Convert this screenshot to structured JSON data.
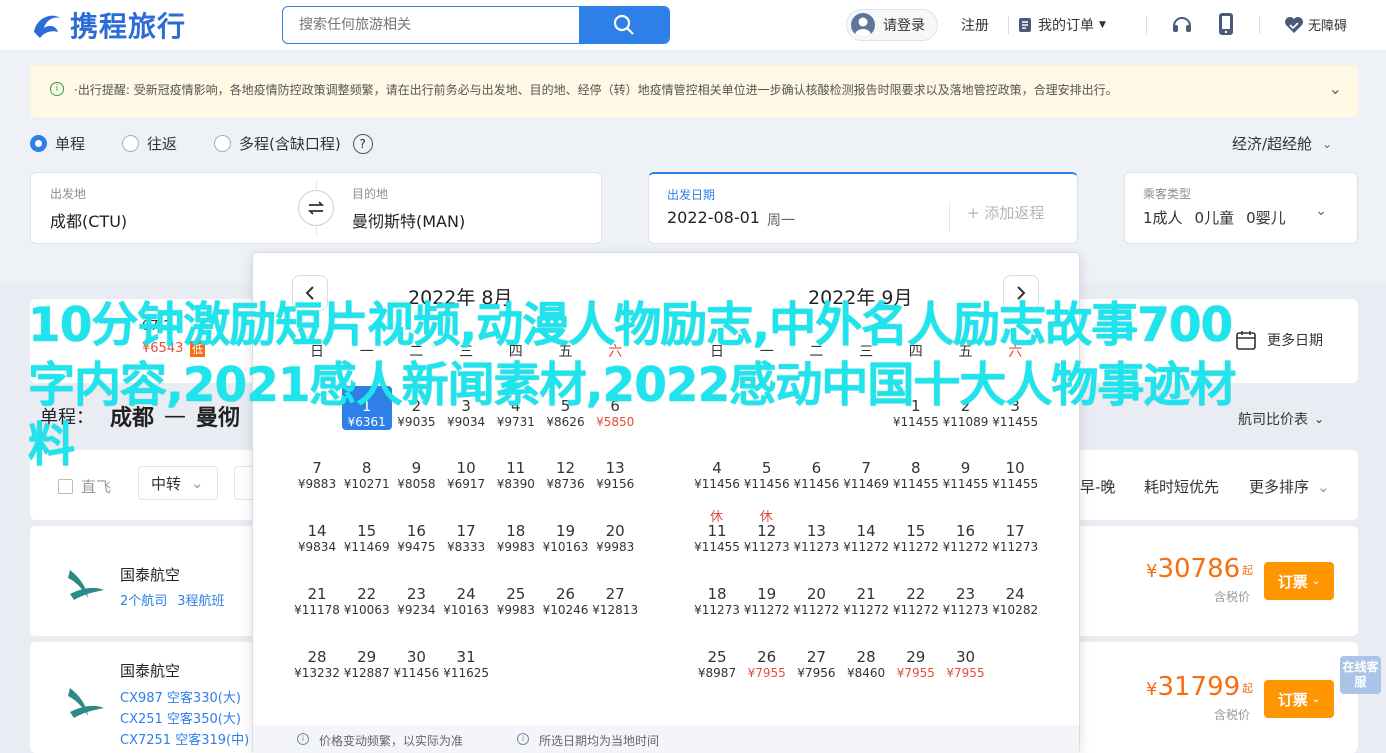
{
  "brand": {
    "name": "携程旅行",
    "color": "#2b6cd8"
  },
  "search": {
    "placeholder": "搜索任何旅游相关"
  },
  "header": {
    "login": "请登录",
    "register": "注册",
    "orders": "我的订单",
    "accessibility": "无障碍"
  },
  "notice": {
    "text": "·出行提醒: 受新冠疫情影响，各地疫情防控政策调整频繁，请在出行前务必与出发地、目的地、经停（转）地疫情管控相关单位进一步确认核酸检测报告时限要求以及落地管控政策，合理安排出行。"
  },
  "trip": {
    "oneway": "单程",
    "roundtrip": "往返",
    "multi": "多程(含缺口程)",
    "cabin": "经济/超经舱"
  },
  "form": {
    "from_label": "出发地",
    "from_value": "成都(CTU)",
    "to_label": "目的地",
    "to_value": "曼彻斯特(MAN)",
    "date_label": "出发日期",
    "date_value": "2022-08-01",
    "date_weekday": "周一",
    "add_return": "+ 添加返程",
    "pax_label": "乘客类型",
    "pax_adult": "1成人",
    "pax_child": "0儿童",
    "pax_infant": "0婴儿"
  },
  "strip": {
    "left_date_partial": "07-2",
    "left_price_partial": "¥6543",
    "left_badge": "低",
    "more_dates": "更多日期"
  },
  "route": {
    "prefix": "单程：",
    "from": "成都",
    "to_partial": "曼彻"
  },
  "sort": {
    "price_trend": "航司比价表"
  },
  "filters": {
    "direct": "直飞",
    "transfer": "中转",
    "time": "早-晚",
    "shortest": "耗时短优先",
    "more_sort": "更多排序"
  },
  "flights": [
    {
      "airline": "国泰航空",
      "sub1": "2个航司",
      "sub2": "3程航班",
      "price": "30786",
      "qi": "起",
      "tax": "含税价",
      "book": "订票"
    },
    {
      "airline": "国泰航空",
      "legs": [
        "CX987 空客330(大)",
        "CX251 空客350(大)",
        "CX7251 空客319(中)"
      ],
      "price": "31799",
      "qi": "起",
      "tax": "含税价",
      "book": "订票"
    }
  ],
  "calendar": {
    "weekdays": [
      "日",
      "一",
      "二",
      "三",
      "四",
      "五",
      "六"
    ],
    "months": [
      {
        "title": "2022年 8月",
        "first_weekday": 1,
        "days": [
          {
            "d": "1",
            "p": "¥6361",
            "sel": true
          },
          {
            "d": "2",
            "p": "¥9035"
          },
          {
            "d": "3",
            "p": "¥9034"
          },
          {
            "d": "4",
            "p": "¥9731"
          },
          {
            "d": "5",
            "p": "¥8626"
          },
          {
            "d": "6",
            "p": "¥5850",
            "low": true
          },
          {
            "d": "7",
            "p": "¥9883"
          },
          {
            "d": "8",
            "p": "¥10271"
          },
          {
            "d": "9",
            "p": "¥8058"
          },
          {
            "d": "10",
            "p": "¥6917"
          },
          {
            "d": "11",
            "p": "¥8390"
          },
          {
            "d": "12",
            "p": "¥8736"
          },
          {
            "d": "13",
            "p": "¥9156"
          },
          {
            "d": "14",
            "p": "¥9834"
          },
          {
            "d": "15",
            "p": "¥11469"
          },
          {
            "d": "16",
            "p": "¥9475"
          },
          {
            "d": "17",
            "p": "¥8333"
          },
          {
            "d": "18",
            "p": "¥9983"
          },
          {
            "d": "19",
            "p": "¥10163"
          },
          {
            "d": "20",
            "p": "¥9983"
          },
          {
            "d": "21",
            "p": "¥11178"
          },
          {
            "d": "22",
            "p": "¥10063"
          },
          {
            "d": "23",
            "p": "¥9234"
          },
          {
            "d": "24",
            "p": "¥10163"
          },
          {
            "d": "25",
            "p": "¥9983"
          },
          {
            "d": "26",
            "p": "¥10246"
          },
          {
            "d": "27",
            "p": "¥12813"
          },
          {
            "d": "28",
            "p": "¥13232"
          },
          {
            "d": "29",
            "p": "¥12887"
          },
          {
            "d": "30",
            "p": "¥11456"
          },
          {
            "d": "31",
            "p": "¥11625"
          }
        ]
      },
      {
        "title": "2022年 9月",
        "first_weekday": 4,
        "days": [
          {
            "d": "1",
            "p": "¥11455"
          },
          {
            "d": "2",
            "p": "¥11089"
          },
          {
            "d": "3",
            "p": "¥11455"
          },
          {
            "d": "4",
            "p": "¥11456"
          },
          {
            "d": "5",
            "p": "¥11456"
          },
          {
            "d": "6",
            "p": "¥11456"
          },
          {
            "d": "7",
            "p": "¥11469"
          },
          {
            "d": "8",
            "p": "¥11455"
          },
          {
            "d": "9",
            "p": "¥11455"
          },
          {
            "d": "10",
            "p": "¥11455"
          },
          {
            "d": "11",
            "p": "¥11455",
            "hol": "休"
          },
          {
            "d": "12",
            "p": "¥11273",
            "hol": "休"
          },
          {
            "d": "13",
            "p": "¥11273"
          },
          {
            "d": "14",
            "p": "¥11272"
          },
          {
            "d": "15",
            "p": "¥11272"
          },
          {
            "d": "16",
            "p": "¥11272"
          },
          {
            "d": "17",
            "p": "¥11273"
          },
          {
            "d": "18",
            "p": "¥11273"
          },
          {
            "d": "19",
            "p": "¥11272"
          },
          {
            "d": "20",
            "p": "¥11272"
          },
          {
            "d": "21",
            "p": "¥11272"
          },
          {
            "d": "22",
            "p": "¥11272"
          },
          {
            "d": "23",
            "p": "¥11273"
          },
          {
            "d": "24",
            "p": "¥10282"
          },
          {
            "d": "25",
            "p": "¥8987"
          },
          {
            "d": "26",
            "p": "¥7955",
            "low": true
          },
          {
            "d": "27",
            "p": "¥7956"
          },
          {
            "d": "28",
            "p": "¥8460"
          },
          {
            "d": "29",
            "p": "¥7955",
            "low": true
          },
          {
            "d": "30",
            "p": "¥7955",
            "low": true
          }
        ]
      }
    ],
    "footer_note1": "价格变动频繁，以实际为准",
    "footer_note2": "所选日期均为当地时间"
  },
  "overlay_text": "10分钟激励短片视频,动漫人物励志,中外名人励志故事700字内容,2021感人新闻素材,2022感动中国十大人物事迹材料",
  "online_service": "在线客服",
  "colors": {
    "accent": "#2f7fe8",
    "price": "#f56f12",
    "book": "#ff9500",
    "low": "#e24d3c"
  }
}
